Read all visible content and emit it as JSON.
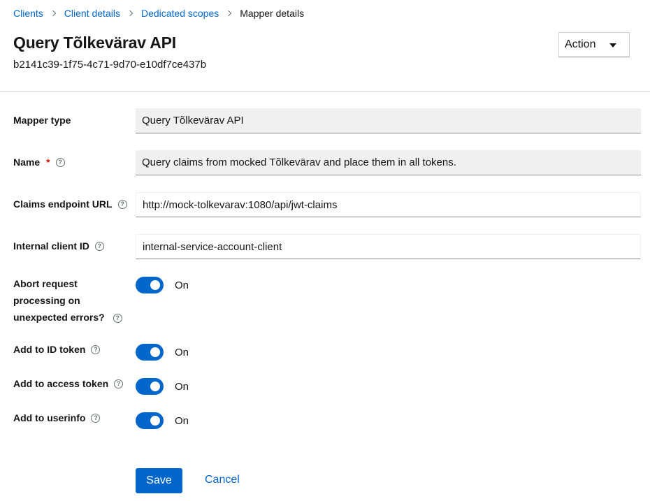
{
  "breadcrumb": {
    "items": [
      "Clients",
      "Client details",
      "Dedicated scopes"
    ],
    "current": "Mapper details"
  },
  "header": {
    "title": "Query Tõlkevärav API",
    "subtitle": "b2141c39-1f75-4c71-9d70-e10df7ce437b",
    "action_label": "Action"
  },
  "form": {
    "mapper_type": {
      "label": "Mapper type",
      "value": "Query Tõlkevärav API"
    },
    "name": {
      "label": "Name",
      "required_mark": "*",
      "value": "Query claims from mocked Tõlkevärav and place them in all tokens."
    },
    "claims_endpoint": {
      "label": "Claims endpoint URL",
      "value": "http://mock-tolkevarav:1080/api/jwt-claims"
    },
    "internal_client_id": {
      "label": "Internal client ID",
      "value": "internal-service-account-client"
    },
    "abort_request": {
      "label": "Abort request processing on unexpected errors?",
      "state": "On"
    },
    "add_id_token": {
      "label": "Add to ID token",
      "state": "On"
    },
    "add_access_token": {
      "label": "Add to access token",
      "state": "On"
    },
    "add_userinfo": {
      "label": "Add to userinfo",
      "state": "On"
    }
  },
  "footer": {
    "save_label": "Save",
    "cancel_label": "Cancel"
  },
  "icons": {
    "help": "help-circle-icon",
    "separator": "chevron-right-icon",
    "caret": "caret-down-icon"
  },
  "colors": {
    "primary": "#0066cc",
    "required": "#c9190b"
  }
}
